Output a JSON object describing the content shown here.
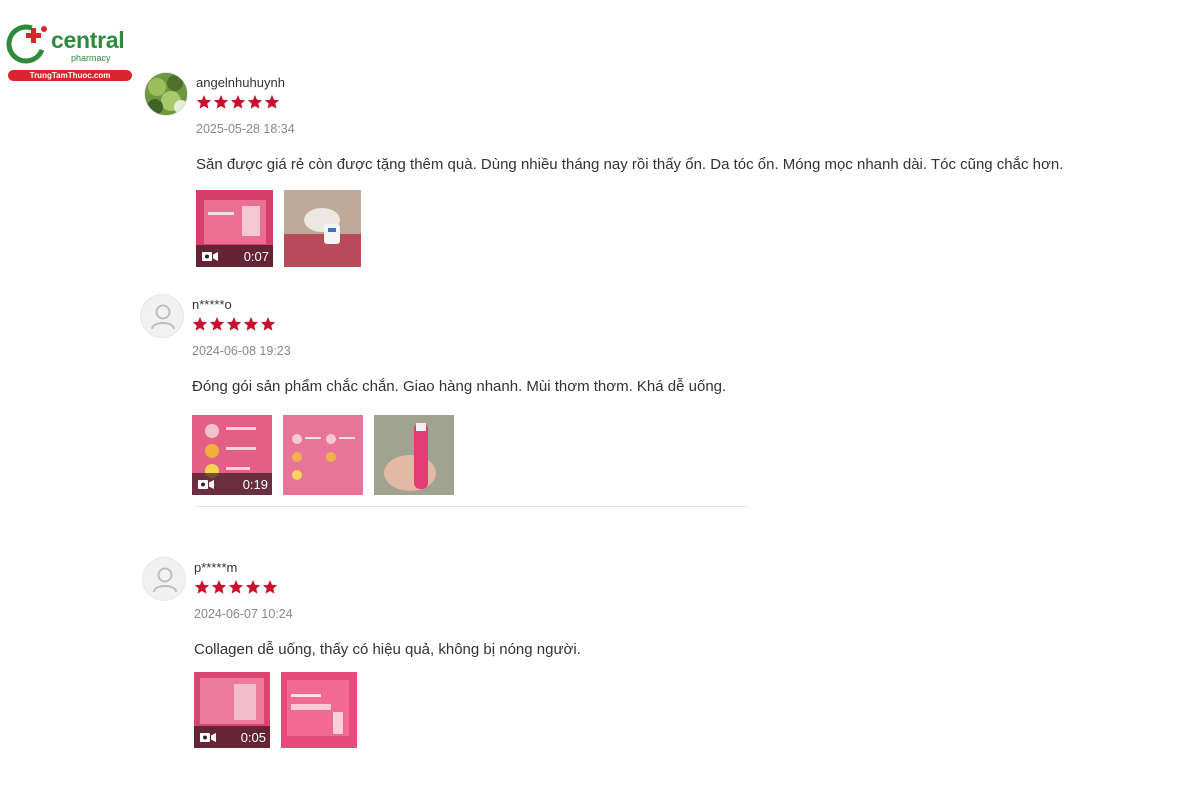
{
  "brand": {
    "name": "central",
    "sub": "pharmacy",
    "site": "TrungTamThuoc.com",
    "green": "#2f8a3e",
    "red": "#d8262d"
  },
  "star_color": "#c8102e",
  "reviews": [
    {
      "username": "angelnhuhuynh",
      "rating": 5,
      "date": "2025-05-28 18:34",
      "comment": "Săn được giá rẻ còn được tặng thêm quà. Dùng nhiều tháng nay rồi thấy ổn. Da tóc ổn. Móng mọc nhanh dài. Tóc cũng chắc hơn.",
      "video_duration": "0:07"
    },
    {
      "username": "n*****o",
      "rating": 5,
      "date": "2024-06-08 19:23",
      "comment": "Đóng gói sản phẩm chắc chắn. Giao hàng nhanh. Mùi thơm thơm. Khá dễ uống.",
      "video_duration": "0:19"
    },
    {
      "username": "p*****m",
      "rating": 5,
      "date": "2024-06-07 10:24",
      "comment": "Collagen dễ uống, thấy có hiệu quả, không bị nóng người.",
      "video_duration": "0:05"
    }
  ]
}
